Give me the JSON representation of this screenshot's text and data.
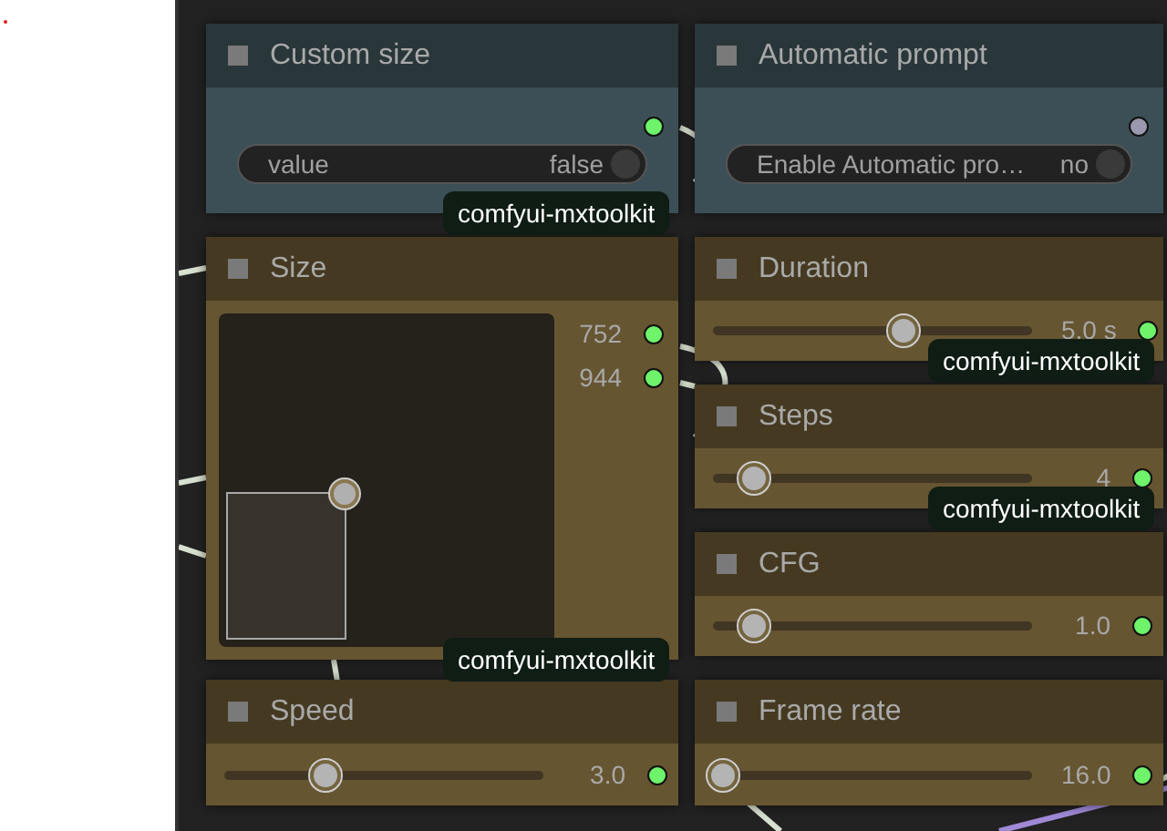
{
  "nodes": [
    {
      "kind": "toggle",
      "title": "Custom size",
      "color": "#3d4f56",
      "widget": {
        "label": "value",
        "value": "false",
        "on": false
      },
      "output_connected": true,
      "badge": "comfyui-mxtoolkit"
    },
    {
      "kind": "toggle",
      "title": "Automatic prompt",
      "color": "#3d4f56",
      "widget": {
        "label": "Enable Automatic pro…",
        "value": "no",
        "on": false
      },
      "output_connected": false
    },
    {
      "kind": "size",
      "title": "Size",
      "color": "#665531",
      "outputs": [
        {
          "label": "752",
          "connected": true
        },
        {
          "label": "944",
          "connected": true
        }
      ],
      "badge": "comfyui-mxtoolkit"
    },
    {
      "kind": "slider",
      "title": "Duration",
      "color": "#665531",
      "level": 0.6,
      "value": "5.0 s",
      "output_connected": true,
      "badge": "comfyui-mxtoolkit"
    },
    {
      "kind": "slider",
      "title": "Steps",
      "color": "#665531",
      "level": 0.1,
      "value": "4",
      "output_connected": true,
      "badge": "comfyui-mxtoolkit"
    },
    {
      "kind": "slider",
      "title": "CFG",
      "color": "#665531",
      "level": 0.1,
      "value": "1.0",
      "output_connected": true
    },
    {
      "kind": "slider",
      "title": "Speed",
      "color": "#665531",
      "level": 0.3,
      "value": "3.0",
      "output_connected": true
    },
    {
      "kind": "slider",
      "title": "Frame rate",
      "color": "#665531",
      "level": 0,
      "value": "16.0",
      "output_connected": true
    }
  ]
}
